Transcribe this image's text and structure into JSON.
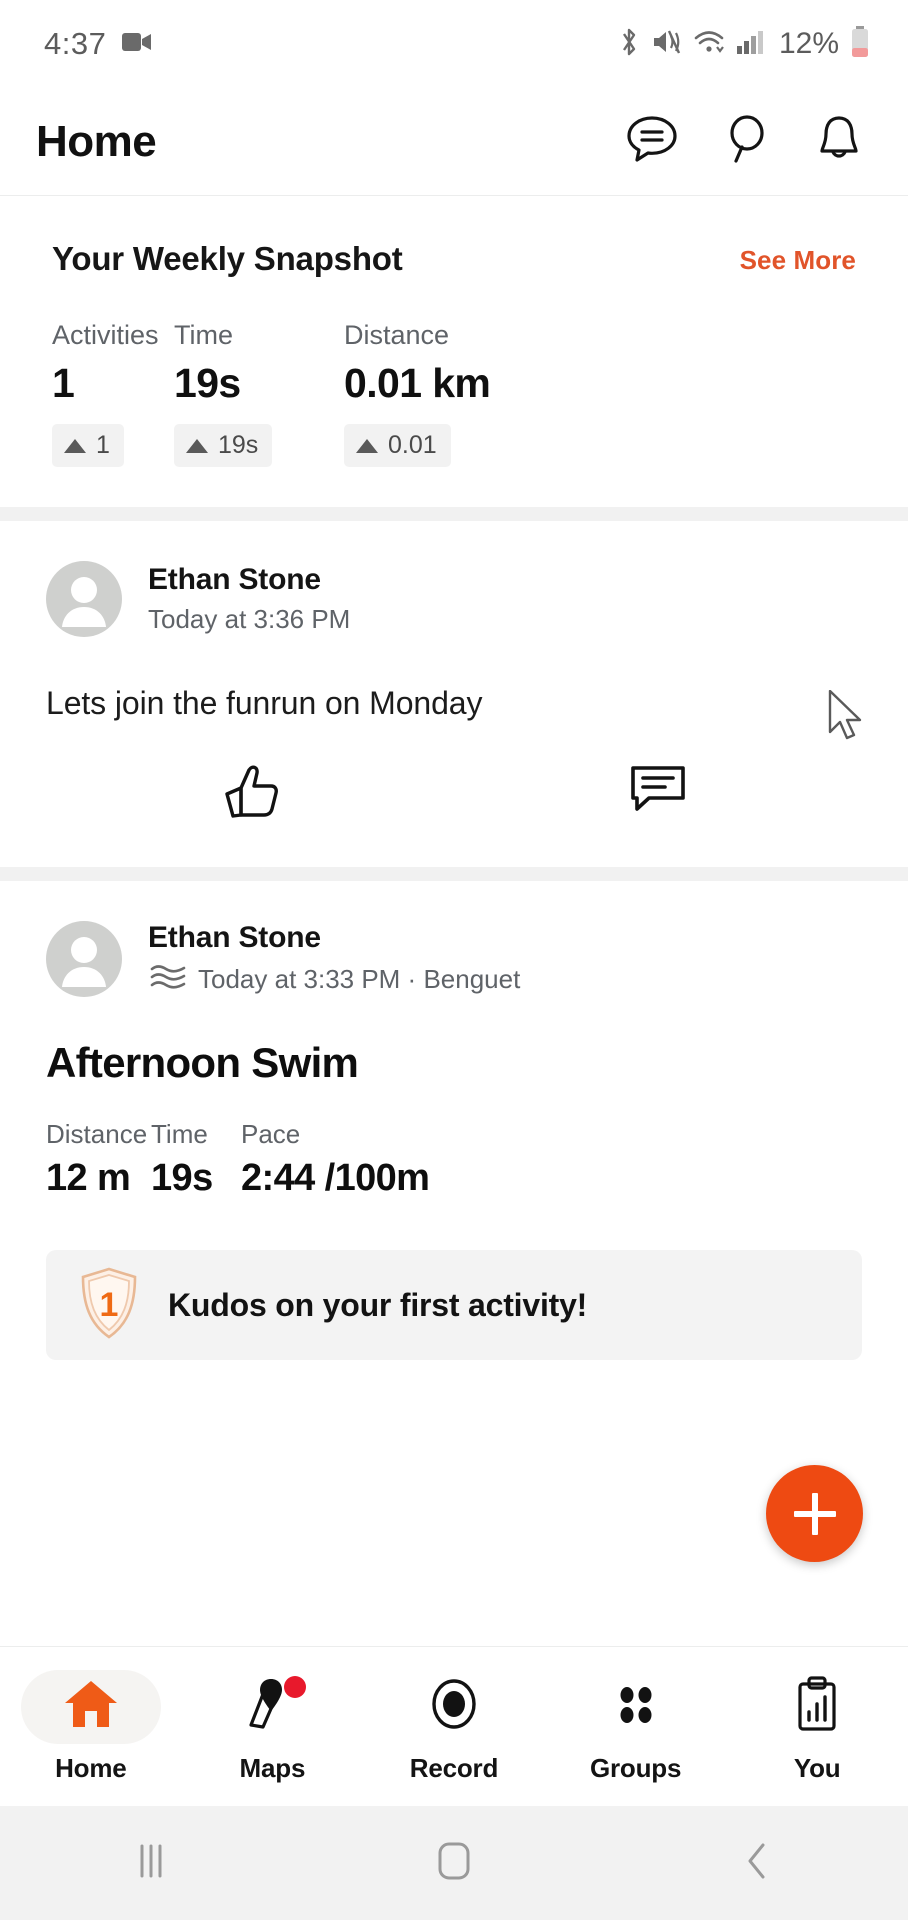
{
  "status_bar": {
    "time": "4:37",
    "battery_percent": "12%",
    "icons": [
      "video-camera-icon",
      "bluetooth-icon",
      "mute-icon",
      "wifi-icon",
      "signal-icon",
      "battery-icon"
    ]
  },
  "header": {
    "title": "Home",
    "icons": [
      "messages-icon",
      "search-icon",
      "notifications-icon"
    ]
  },
  "snapshot": {
    "title": "Your Weekly Snapshot",
    "see_more_label": "See More",
    "accent_color": "#e1542a",
    "stats": [
      {
        "label": "Activities",
        "value": "1",
        "delta": "1"
      },
      {
        "label": "Time",
        "value": "19s",
        "delta": "19s"
      },
      {
        "label": "Distance",
        "value": "0.01 km",
        "delta": "0.01"
      }
    ]
  },
  "feed": {
    "post": {
      "author": "Ethan Stone",
      "timestamp": "Today at 3:36 PM",
      "text": "Lets join the funrun on Monday",
      "actions": [
        "thumbs-up-icon",
        "comment-icon"
      ]
    },
    "activity": {
      "author": "Ethan Stone",
      "sport_icon": "swim-waves-icon",
      "timestamp": "Today at 3:33 PM · Benguet",
      "title": "Afternoon Swim",
      "stats": [
        {
          "label": "Distance",
          "value": "12 m"
        },
        {
          "label": "Time",
          "value": "19s"
        },
        {
          "label": "Pace",
          "value": "2:44 /100m"
        }
      ],
      "kudos": {
        "badge_number": "1",
        "text": "Kudos on your first activity!"
      }
    }
  },
  "fab": {
    "icon": "plus-icon",
    "color": "#ee4a12"
  },
  "bottom_nav": {
    "items": [
      {
        "label": "Home",
        "icon": "home-icon",
        "active": true,
        "badge": false
      },
      {
        "label": "Maps",
        "icon": "map-pin-icon",
        "active": false,
        "badge": true
      },
      {
        "label": "Record",
        "icon": "record-icon",
        "active": false,
        "badge": false
      },
      {
        "label": "Groups",
        "icon": "groups-icon",
        "active": false,
        "badge": false
      },
      {
        "label": "You",
        "icon": "clipboard-chart-icon",
        "active": false,
        "badge": false
      }
    ]
  },
  "system_nav": {
    "items": [
      "recents-icon",
      "home-button-icon",
      "back-icon"
    ]
  }
}
